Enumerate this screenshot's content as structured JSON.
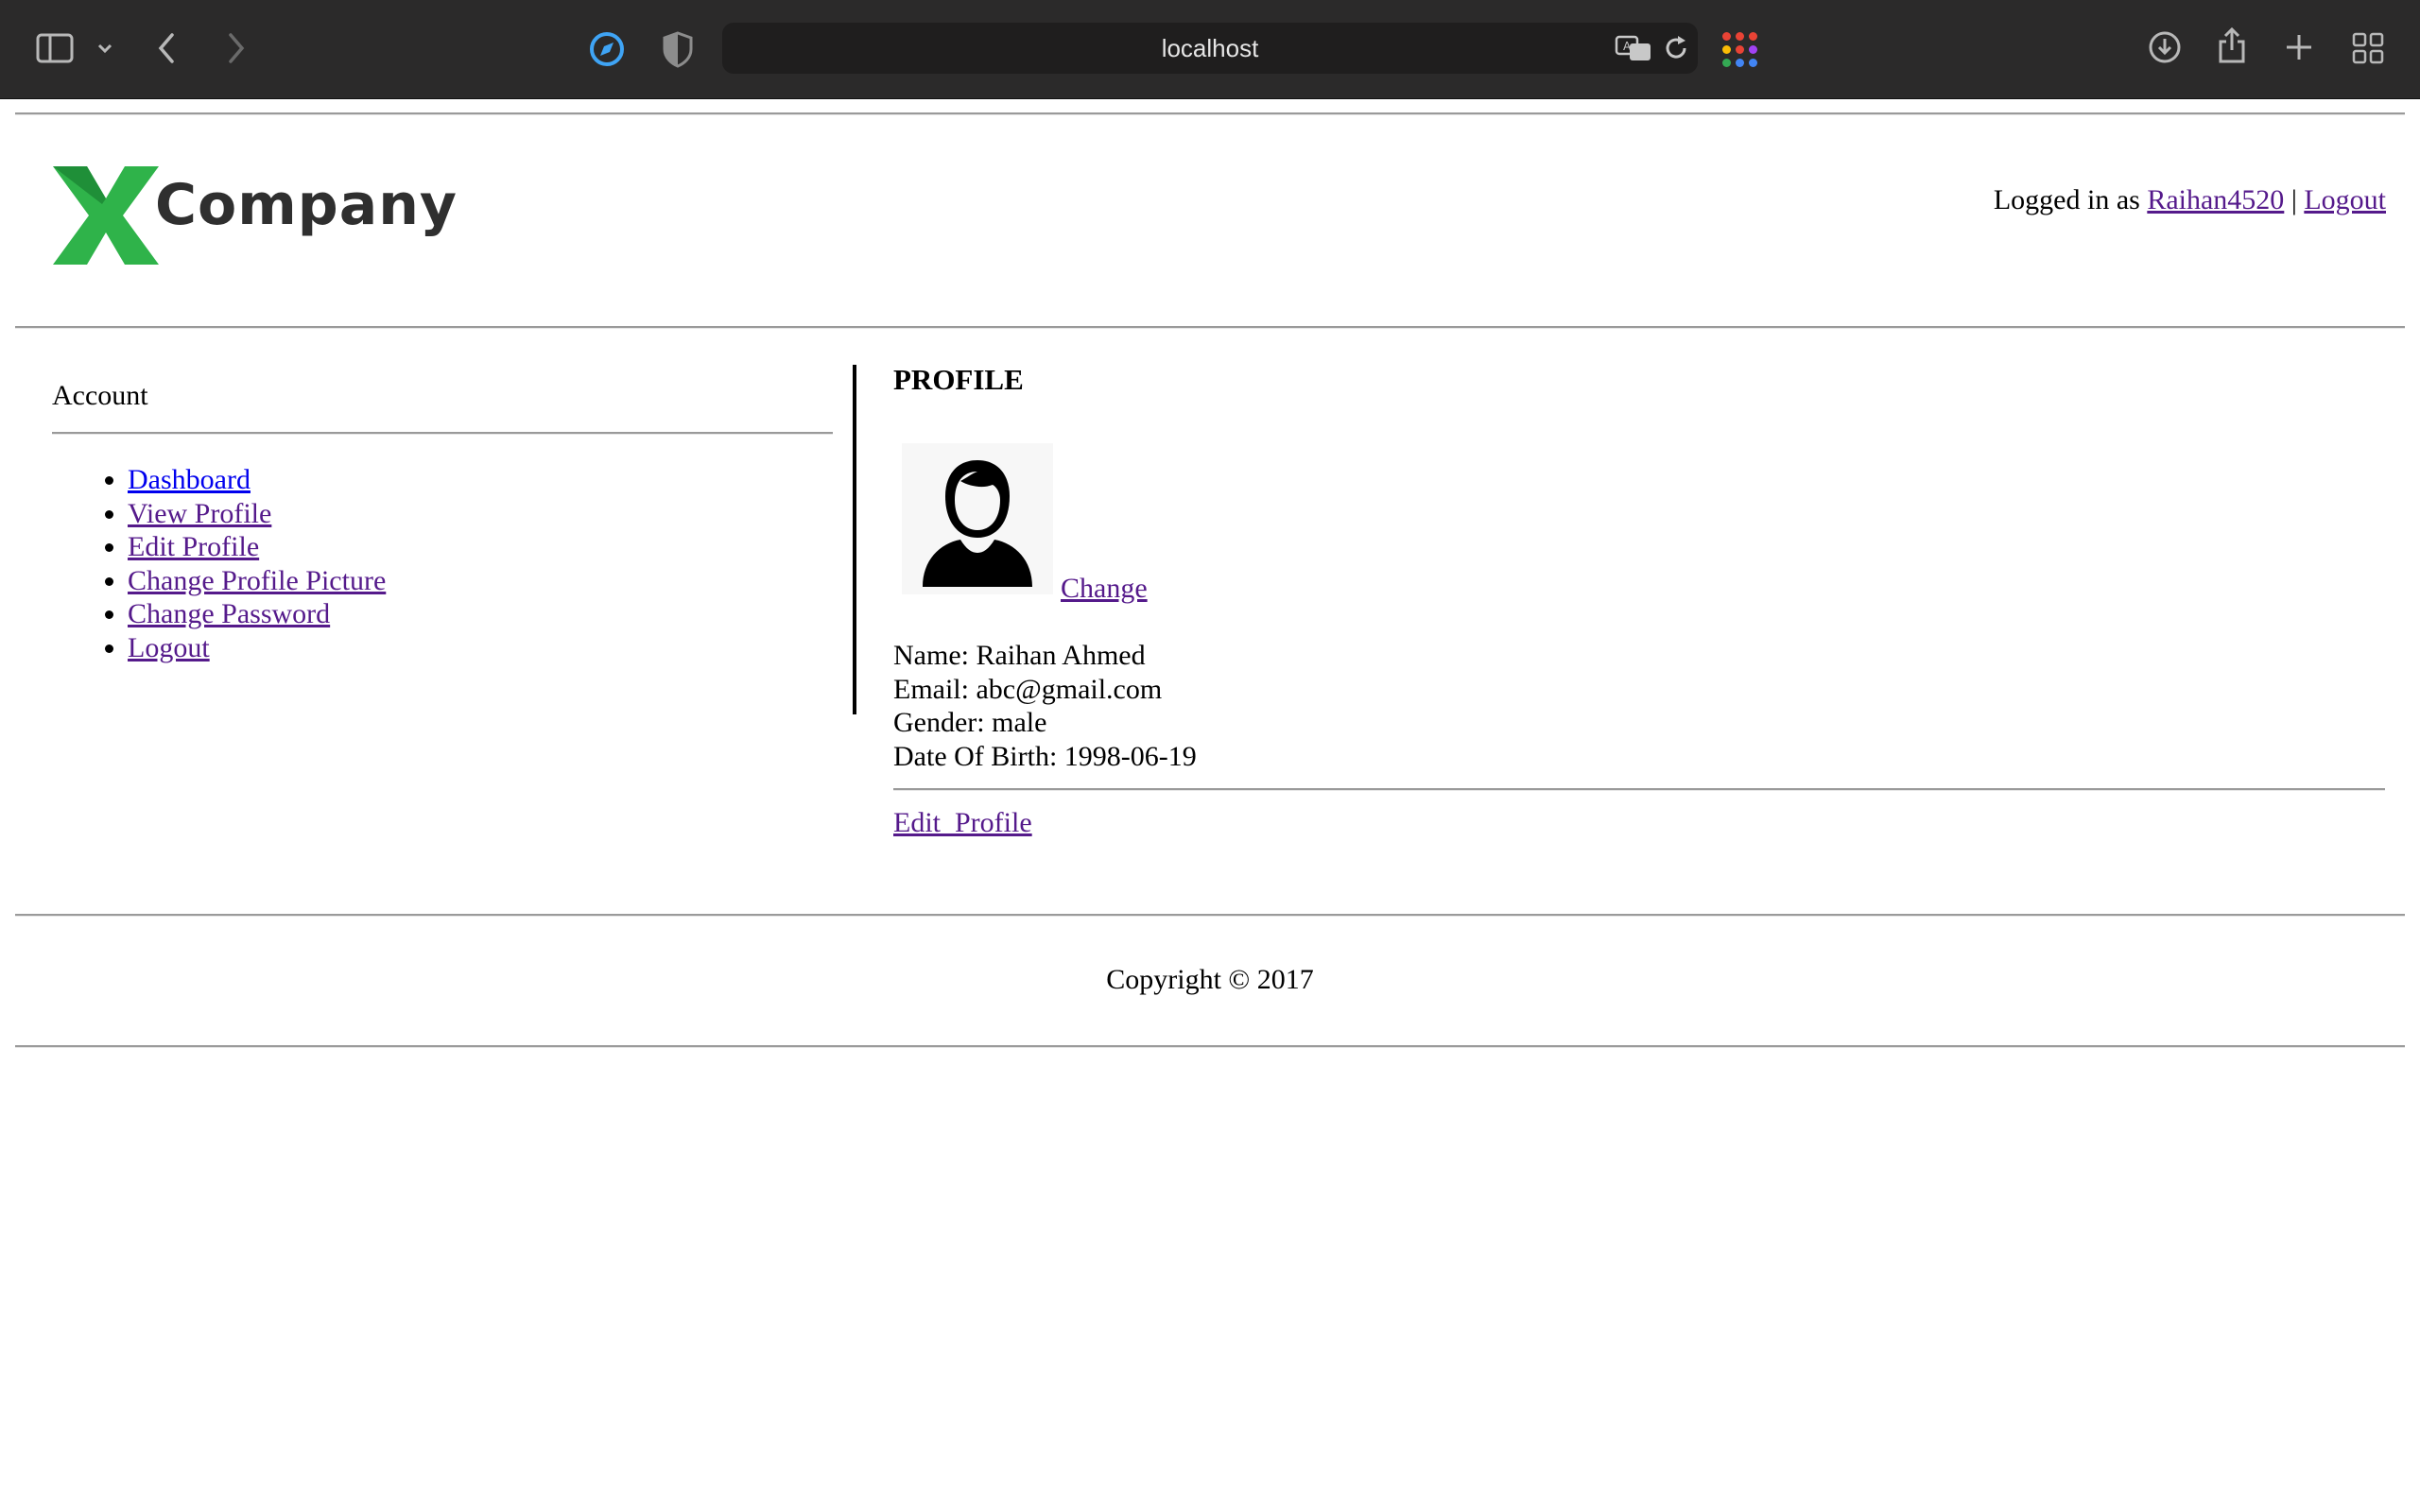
{
  "browser": {
    "url": "localhost"
  },
  "header": {
    "logo_letter": "X",
    "logo_word": "Company",
    "logged_in_prefix": "Logged in as",
    "username": "Raihan4520",
    "separator": "|",
    "logout": "Logout"
  },
  "sidebar": {
    "title": "Account",
    "items": [
      {
        "label": "Dashboard"
      },
      {
        "label": "View Profile"
      },
      {
        "label": "Edit Profile"
      },
      {
        "label": "Change Profile Picture"
      },
      {
        "label": "Change Password"
      },
      {
        "label": "Logout"
      }
    ]
  },
  "profile": {
    "title": "PROFILE",
    "change_link": "Change",
    "name": "Name: Raihan Ahmed",
    "email": "Email: abc@gmail.com",
    "gender": "Gender: male",
    "dob": "Date Of Birth: 1998-06-19",
    "edit_link": "Edit  Profile"
  },
  "footer": {
    "copyright": "Copyright © 2017"
  },
  "colors": {
    "logo_green": "#2fb34a",
    "link_visited": "#551a8b",
    "link_unvisited": "#0000ee"
  }
}
